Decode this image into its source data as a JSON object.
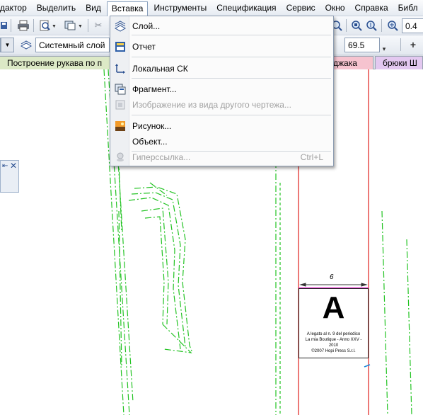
{
  "menubar": {
    "items": [
      {
        "label": "дактор"
      },
      {
        "label": "Выделить"
      },
      {
        "label": "Вид"
      },
      {
        "label": "Вставка"
      },
      {
        "label": "Инструменты"
      },
      {
        "label": "Спецификация"
      },
      {
        "label": "Сервис"
      },
      {
        "label": "Окно"
      },
      {
        "label": "Справка"
      },
      {
        "label": "Библ"
      }
    ]
  },
  "toolbar": {
    "zoom_value": "0.4",
    "layer_combo": "Системный слой",
    "step_value": "69.5"
  },
  "tabs": [
    {
      "label": "Построение рукава по п"
    },
    {
      "label": "джака"
    },
    {
      "label": "брюки Ш"
    }
  ],
  "insert_menu": {
    "items": [
      {
        "label": "Слой...",
        "icon": "layer-icon",
        "enabled": true
      },
      {
        "label": "Отчет",
        "icon": "report-icon",
        "enabled": true
      },
      {
        "label": "Локальная СК",
        "icon": "local-cs-icon",
        "enabled": true
      },
      {
        "label": "Фрагмент...",
        "icon": "fragment-icon",
        "enabled": true
      },
      {
        "label": "Изображение из вида другого чертежа...",
        "icon": "view-image-icon",
        "enabled": false
      },
      {
        "label": "Рисунок...",
        "icon": "picture-icon",
        "enabled": true
      },
      {
        "label": "Объект...",
        "icon": "object-icon",
        "enabled": true
      },
      {
        "label": "Гиперссылка...",
        "icon": "hyperlink-icon",
        "enabled": false,
        "shortcut": "Ctrl+L"
      }
    ]
  },
  "drawing": {
    "dimension_label": "6",
    "stamp_letter": "A",
    "stamp_lines": [
      "A legato al n. 9 del periodico",
      "La mia Boutique - Anno XXV - 2010",
      "©2007 Hopi Press S.r.l."
    ]
  },
  "colors": {
    "menu_highlight": "#ffffff",
    "pattern_lines": "#22c322",
    "frame_lines": "#e0201c",
    "magenta_line": "#e020c8",
    "tab_active": "#f6c3cf",
    "tab_purple": "#e3c8f0"
  }
}
